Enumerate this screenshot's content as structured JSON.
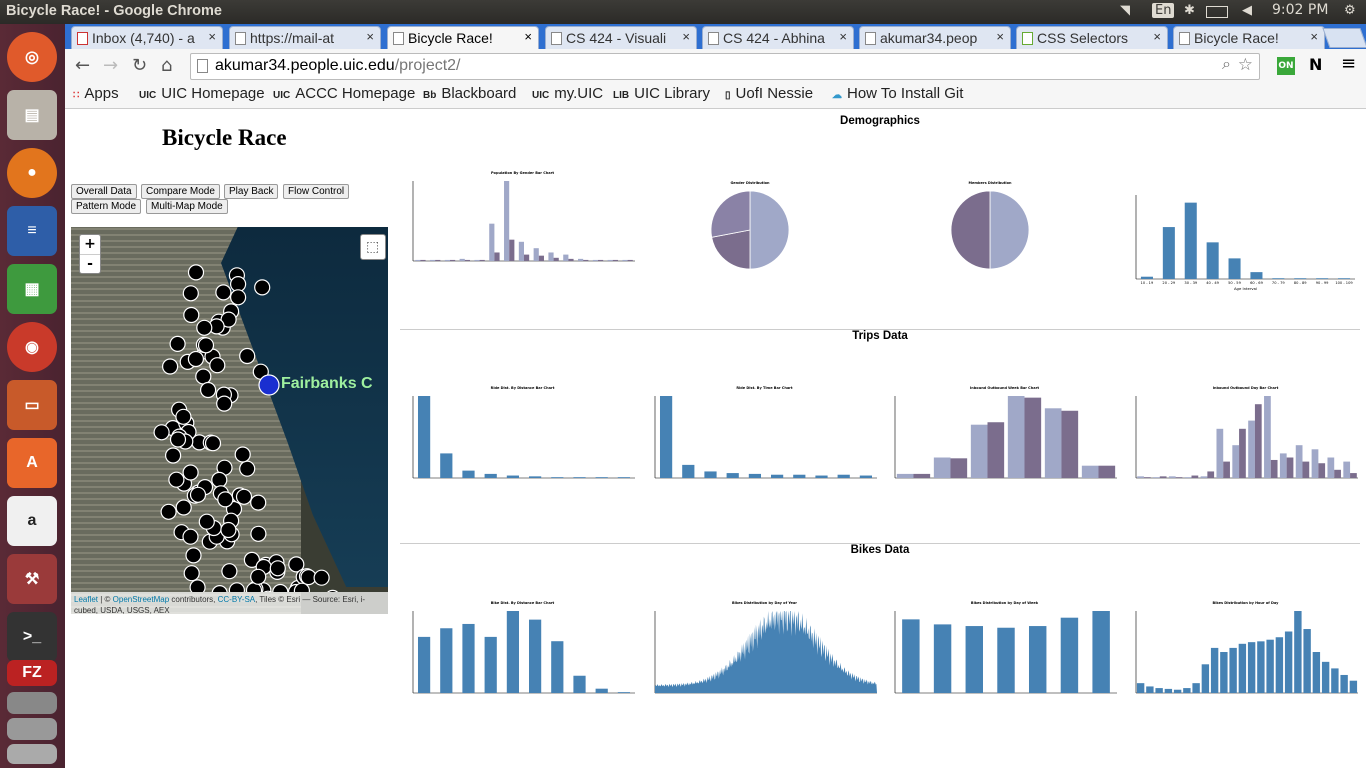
{
  "os": {
    "window_title": "Bicycle Race! - Google Chrome",
    "lang": "En",
    "time": "9:02 PM"
  },
  "tabs": [
    {
      "label": "Inbox (4,740) - a",
      "close": "×"
    },
    {
      "label": "https://mail-at",
      "close": "×"
    },
    {
      "label": "Bicycle Race!",
      "close": "×",
      "active": true
    },
    {
      "label": "CS 424 - Visuali",
      "close": "×"
    },
    {
      "label": "CS 424 - Abhina",
      "close": "×"
    },
    {
      "label": "akumar34.peop",
      "close": "×"
    },
    {
      "label": "CSS Selectors",
      "close": "×"
    },
    {
      "label": "Bicycle Race!",
      "close": "×"
    }
  ],
  "address": {
    "host": "akumar34.people.uic.edu",
    "path": "/project2/"
  },
  "bookmarks": [
    {
      "label": "Apps",
      "icon": "grid"
    },
    {
      "label": "UIC Homepage",
      "icon": "UIC"
    },
    {
      "label": "ACCC Homepage",
      "icon": "UIC"
    },
    {
      "label": "Blackboard",
      "icon": "Bb"
    },
    {
      "label": "my.UIC",
      "icon": "UIC"
    },
    {
      "label": "UIC Library",
      "icon": "LIB"
    },
    {
      "label": "UofI Nessie",
      "icon": "page"
    },
    {
      "label": "How To Install Git",
      "icon": "cloud"
    }
  ],
  "page": {
    "title": "Bicycle Race",
    "buttons": [
      "Overall Data",
      "Compare Mode",
      "Play Back",
      "Flow Control",
      "Pattern Mode",
      "Multi-Map Mode"
    ],
    "map": {
      "zoom_in": "+",
      "zoom_out": "-",
      "station_label": "Fairbanks C",
      "attr_leaflet": "Leaflet",
      "attr_sep": " | © ",
      "attr_osm": "OpenStreetMap",
      "attr_contrib": " contributors, ",
      "attr_cc": "CC-BY-SA",
      "attr_rest": ", Tiles © Esri — Source: Esri, i-cubed, USDA, USGS, AEX"
    },
    "sections": {
      "demographics": "Demographics",
      "trips": "Trips Data",
      "bikes": "Bikes Data"
    }
  },
  "colors": {
    "bar": "#4682b4",
    "lavender": "#a0a8c8",
    "purple": "#7b6d8d"
  },
  "chart_data": [
    {
      "id": "pop-gender",
      "type": "bar",
      "title": "Population By Gender Bar Chart",
      "series": [
        {
          "values": [
            1,
            1,
            1,
            2,
            1,
            35,
            75,
            18,
            12,
            8,
            6,
            2,
            1,
            1,
            1
          ]
        },
        {
          "values": [
            1,
            1,
            1,
            1,
            1,
            8,
            20,
            6,
            5,
            3,
            2,
            1,
            1,
            1,
            1
          ]
        }
      ]
    },
    {
      "id": "gender-dist",
      "type": "pie",
      "title": "Gender Distribution",
      "values": [
        50,
        22,
        28
      ]
    },
    {
      "id": "members-dist",
      "type": "pie",
      "title": "Members Distribution",
      "values": [
        50,
        50
      ]
    },
    {
      "id": "age-dist",
      "type": "bar",
      "title": "",
      "categories": [
        "10 - 19",
        "20 - 29",
        "30 - 39",
        "40 - 49",
        "50 - 59",
        "60 - 69",
        "70 - 79",
        "80 - 89",
        "90 - 99",
        "100 - 109"
      ],
      "values": [
        3,
        68,
        100,
        48,
        27,
        9,
        1,
        1,
        1,
        1
      ],
      "xlabel": "Age Interval",
      "ylim": [
        0,
        110
      ]
    },
    {
      "id": "ride-dist",
      "type": "bar",
      "title": "Ride Dist. By Distance Bar Chart",
      "values": [
        100,
        30,
        9,
        5,
        3,
        2,
        1,
        1,
        1,
        1
      ]
    },
    {
      "id": "ride-time",
      "type": "bar",
      "title": "Ride Dist. By Time Bar Chart",
      "values": [
        100,
        16,
        8,
        6,
        5,
        4,
        4,
        3,
        4,
        3
      ]
    },
    {
      "id": "inbound-outbound-week",
      "type": "bar",
      "title": "Inbound Outbound Week Bar Chart",
      "series": [
        {
          "values": [
            5,
            25,
            65,
            100,
            85,
            15
          ]
        },
        {
          "values": [
            5,
            24,
            68,
            98,
            82,
            15
          ]
        }
      ]
    },
    {
      "id": "inbound-outbound-day",
      "type": "bar",
      "title": "Inbound Outbound Day Bar Chart",
      "series": [
        {
          "values": [
            2,
            1,
            2,
            1,
            2,
            60,
            40,
            70,
            100,
            30,
            40,
            35,
            25,
            20
          ]
        },
        {
          "values": [
            1,
            2,
            1,
            3,
            8,
            20,
            60,
            90,
            22,
            25,
            20,
            18,
            10,
            6
          ]
        }
      ]
    },
    {
      "id": "bike-dist",
      "type": "bar",
      "title": "Bike Dist. By Distance Bar Chart",
      "values": [
        65,
        75,
        80,
        65,
        95,
        85,
        60,
        20,
        5,
        1
      ]
    },
    {
      "id": "bike-year",
      "type": "area",
      "title": "Bikes Distribution by Day of Year"
    },
    {
      "id": "bike-week",
      "type": "bar",
      "title": "Bikes Distribution by Day of Week",
      "values": [
        88,
        82,
        80,
        78,
        80,
        90,
        98
      ]
    },
    {
      "id": "bike-hour",
      "type": "bar",
      "title": "Bikes Distribution by Hour of Day",
      "values": [
        12,
        8,
        6,
        5,
        4,
        6,
        12,
        35,
        55,
        50,
        55,
        60,
        62,
        63,
        65,
        68,
        75,
        100,
        78,
        50,
        38,
        30,
        22,
        15
      ]
    }
  ]
}
